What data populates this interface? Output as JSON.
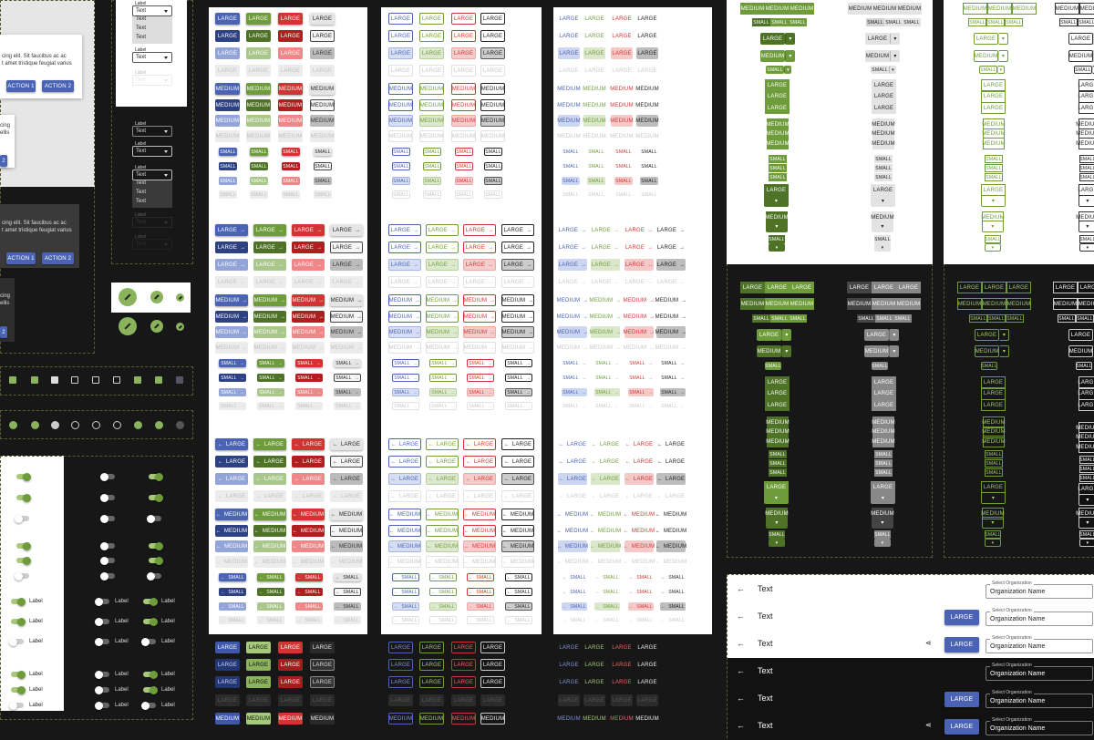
{
  "cards": {
    "body_text_1": "cing elit. Sit faucibus ac ac",
    "body_text_2": "t amet tristique feugiat varius",
    "short_text_1": "cing",
    "short_text_2": "ellis",
    "action1": "ACTION 1",
    "action2": "ACTION 2",
    "edge_label": "2"
  },
  "selects": {
    "label": "Label",
    "value": "Text",
    "options": [
      "Text",
      "Text",
      "Text"
    ]
  },
  "switch_label": "Label",
  "sizes": {
    "large": "LARGE",
    "medium": "MEDIUM",
    "small": "SMALL"
  },
  "arrows": {
    "right": "→",
    "left": "←"
  },
  "split_arrow": "▾",
  "app_rows": {
    "back_arrow": "←",
    "title": "Text",
    "large_button": "LARGE",
    "share_icon": "⋖",
    "select_label": "Select Organization",
    "select_value": "Organization Name"
  },
  "colors": {
    "blue": "#4a63b5",
    "green": "#6f9c3b",
    "red": "#d23434",
    "grey": "#e5e5e5"
  }
}
